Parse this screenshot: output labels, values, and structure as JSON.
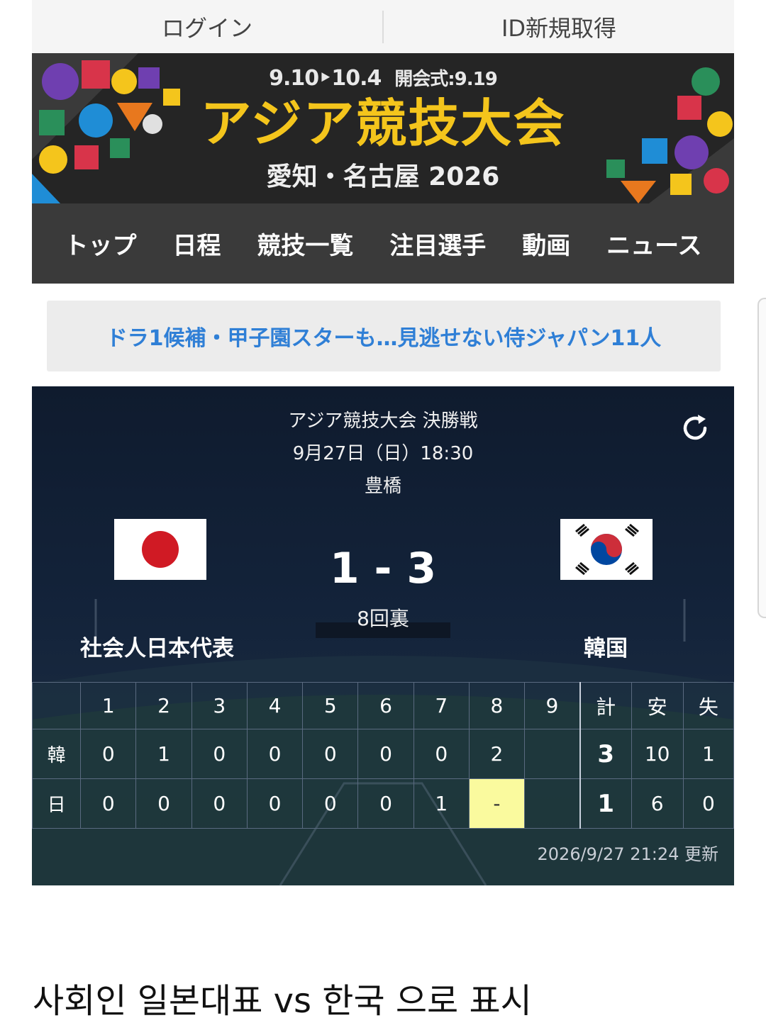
{
  "auth": {
    "login": "ログイン",
    "register": "ID新規取得"
  },
  "banner": {
    "dates_main": "9.10‣10.4",
    "dates_ceremony": "開会式:9.19",
    "title": "アジア競技大会",
    "subtitle": "愛知・名古屋 2026"
  },
  "nav": {
    "items": [
      "トップ",
      "日程",
      "競技一覧",
      "注目選手",
      "動画",
      "ニュース"
    ]
  },
  "promo": {
    "text": "ドラ1候補・甲子園スターも…見逃せない侍ジャパン11人"
  },
  "game": {
    "title": "アジア競技大会 決勝戦",
    "datetime": "9月27日（日）18:30",
    "venue": "豊橋",
    "score": "1 - 3",
    "inning": "8回裏",
    "team_left": "社会人日本代表",
    "team_right": "韓国",
    "updated": "2026/9/27 21:24 更新",
    "table": {
      "header": [
        "1",
        "2",
        "3",
        "4",
        "5",
        "6",
        "7",
        "8",
        "9",
        "計",
        "安",
        "失"
      ],
      "rows": [
        {
          "team": "韓",
          "innings": [
            "0",
            "1",
            "0",
            "0",
            "0",
            "0",
            "0",
            "2",
            ""
          ],
          "total": "3",
          "hits": "10",
          "errors": "1"
        },
        {
          "team": "日",
          "innings": [
            "0",
            "0",
            "0",
            "0",
            "0",
            "0",
            "1",
            "-",
            ""
          ],
          "total": "1",
          "hits": "6",
          "errors": "0"
        }
      ]
    }
  },
  "caption": "사회인 일본대표 vs 한국 으로 표시",
  "icons": {
    "refresh": "refresh-icon",
    "flag_left": "japan-flag",
    "flag_right": "korea-flag"
  },
  "colors": {
    "banner_title": "#f4c51c",
    "promo_link": "#2f7fd6",
    "current_inning": "#fafa9e"
  }
}
